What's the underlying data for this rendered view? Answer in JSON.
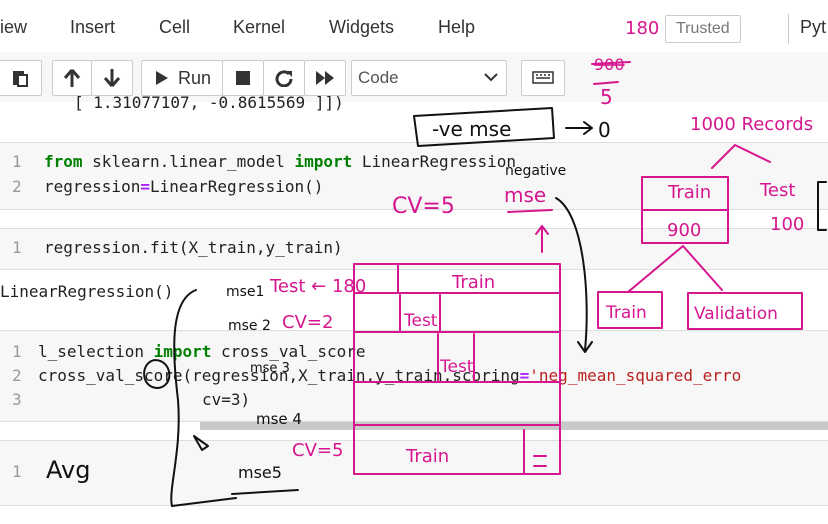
{
  "menu": {
    "items": [
      "iew",
      "Insert",
      "Cell",
      "Kernel",
      "Widgets",
      "Help"
    ],
    "trusted": "Trusted",
    "kernel": "Pyt"
  },
  "toolbar": {
    "run_label": "Run",
    "cell_type": "Code"
  },
  "cells": {
    "output_top": "[ 1.31077107, -0.8615569 ]])",
    "c1_prompt_1": "1",
    "c1_prompt_2": "2",
    "c1_kw_from": "from",
    "c1_module": " sklearn.linear_model ",
    "c1_kw_import": "import",
    "c1_class": " LinearRegression",
    "c1_line2_a": "regression",
    "c1_line2_op": "=",
    "c1_line2_b": "LinearRegression()",
    "c2_prompt": "1",
    "c2_line": "regression.fit(X_train,y_train)",
    "out2": "LinearRegression()",
    "c3_p1": "1",
    "c3_p2": "2",
    "c3_p3": "3",
    "c3_line1_a": "l_selection ",
    "c3_line1_kw": "import",
    "c3_line1_b": " cross_val_score",
    "c3_line2_a": "cross_val_score(regression,X_train,y_train,scoring",
    "c3_line2_op": "=",
    "c3_line2_str": "'neg_mean_squared_erro",
    "c3_line3": "cv=3)",
    "c4_prompt": "1"
  },
  "annotations": {
    "n180_top": "180",
    "n900_struck": "900",
    "n5": "5",
    "ve_mse": "-ve mse",
    "arrow_zero": "0",
    "records": "1000 Records",
    "negative": "negative",
    "mse": "mse",
    "cv5": "CV=5",
    "train": "Train",
    "test": "Test",
    "n900": "900",
    "n100": "100",
    "validation": "Validation",
    "mse1": "mse1",
    "mse2": "mse 2",
    "mse3": "mse 3",
    "mse4": "mse 4",
    "mse5": "mse5",
    "test_180": "Test ← 180",
    "cv2": "CV=2",
    "cv5b": "CV=5",
    "avg": "Avg",
    "stroke_color": "#d6168f"
  }
}
